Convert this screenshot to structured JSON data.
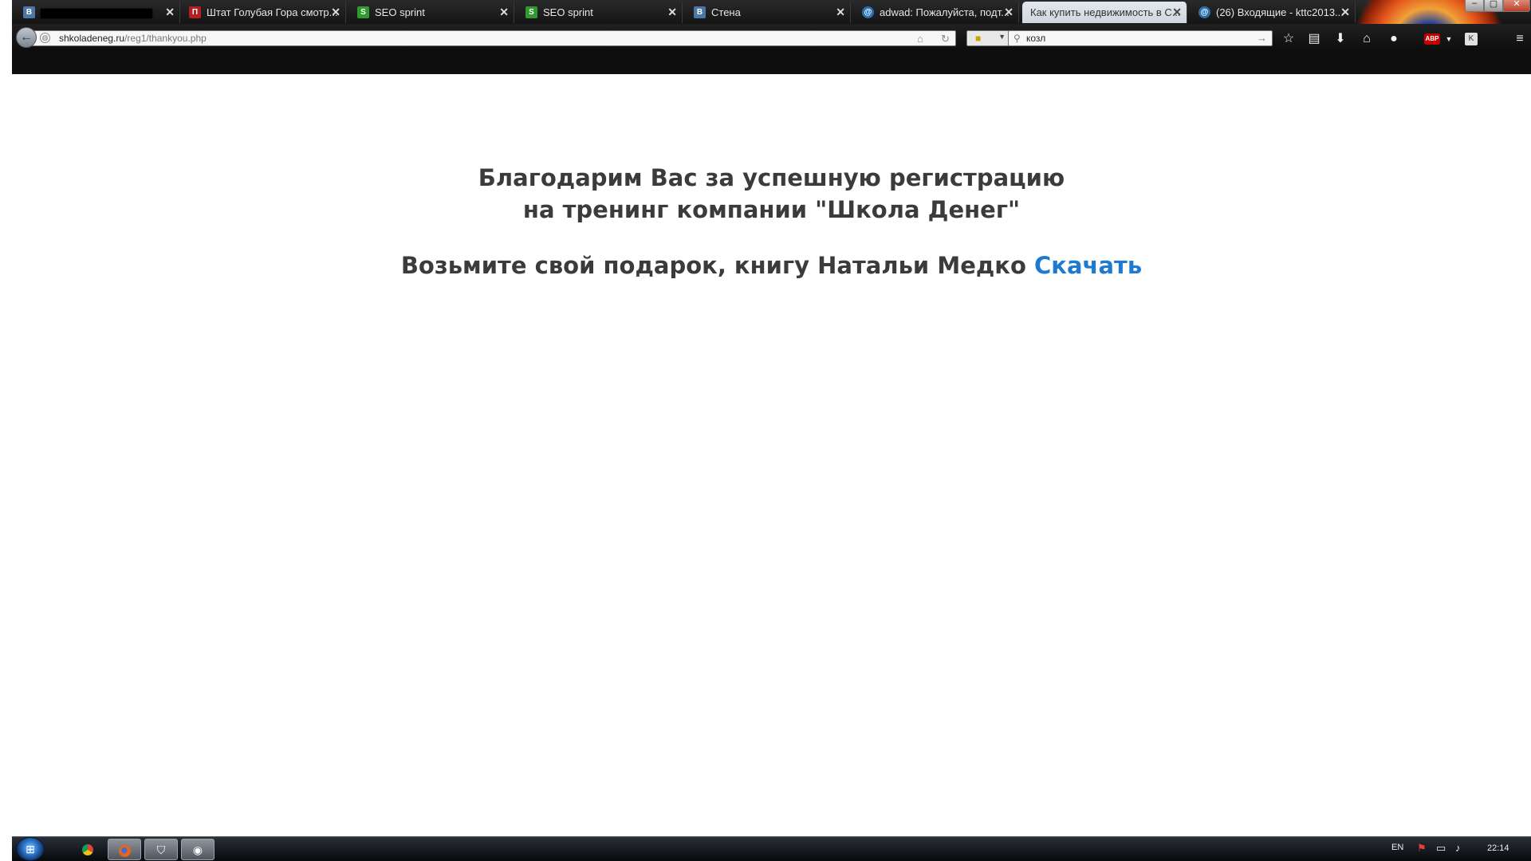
{
  "browser": {
    "tabs": [
      {
        "title": "",
        "favicon": "vk-icon",
        "redacted": true
      },
      {
        "title": "Штат Голубая Гора смотр...",
        "favicon": "tv-icon"
      },
      {
        "title": "SEO sprint",
        "favicon": "seosprint-icon"
      },
      {
        "title": "SEO sprint",
        "favicon": "seosprint-icon"
      },
      {
        "title": "Стена",
        "favicon": "vk-icon"
      },
      {
        "title": "adwad: Пожалуйста, подт...",
        "favicon": "mail-icon"
      },
      {
        "title": "Как купить недвижимость в С...",
        "favicon": "none",
        "active": true
      },
      {
        "title": "(26) Входящие - kttc2013...",
        "favicon": "mail-icon"
      }
    ],
    "new_tab_label": "+",
    "url_domain": "shkoladeneg.ru",
    "url_path": "/reg1/thankyou.php",
    "search_value": "козл"
  },
  "page": {
    "thanks_line1": "Благодарим Вас за успешную регистрацию",
    "thanks_line2": "на тренинг компании \"Школа Денег\"",
    "gift_text": "Возьмите свой подарок, книгу Натальи Медко",
    "download_label": "Скачать",
    "link_color": "#1c7bd1"
  },
  "taskbar": {
    "language": "EN",
    "clock": "22:14"
  }
}
